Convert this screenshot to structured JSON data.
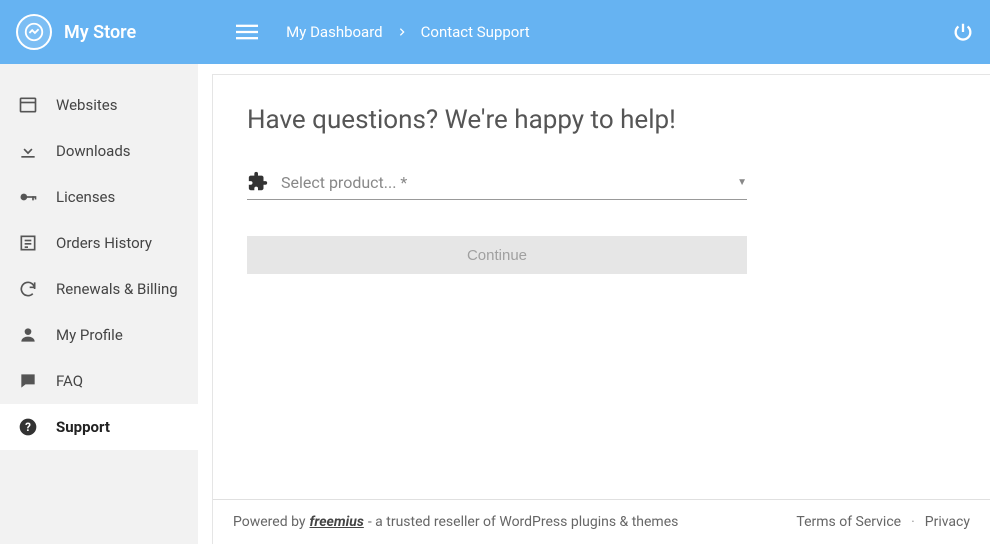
{
  "header": {
    "store_name": "My Store",
    "breadcrumb": {
      "dashboard": "My Dashboard",
      "current": "Contact Support"
    }
  },
  "sidebar": {
    "items": [
      {
        "label": "Websites"
      },
      {
        "label": "Downloads"
      },
      {
        "label": "Licenses"
      },
      {
        "label": "Orders History"
      },
      {
        "label": "Renewals & Billing"
      },
      {
        "label": "My Profile"
      },
      {
        "label": "FAQ"
      },
      {
        "label": "Support"
      }
    ]
  },
  "main": {
    "title": "Have questions? We're happy to help!",
    "select_placeholder": "Select product... *",
    "continue_label": "Continue"
  },
  "footer": {
    "powered_by": "Powered by",
    "brand": "freemius",
    "tagline": " - a trusted reseller of WordPress plugins & themes",
    "terms": "Terms of Service",
    "privacy": "Privacy"
  }
}
